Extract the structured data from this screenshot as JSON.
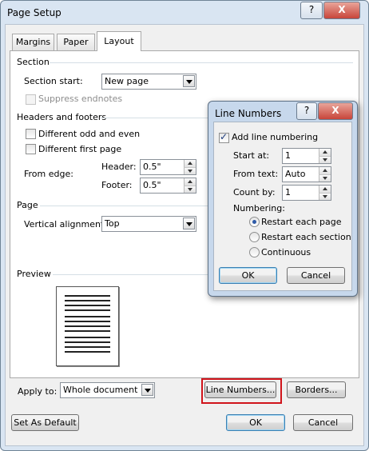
{
  "dialog": {
    "title": "Page Setup",
    "help_label": "?",
    "close_label": "X",
    "tabs": [
      {
        "label": "Margins",
        "active": false
      },
      {
        "label": "Paper",
        "active": false
      },
      {
        "label": "Layout",
        "active": true
      }
    ]
  },
  "section": {
    "header": "Section",
    "section_start_label": "Section start:",
    "section_start_value": "New page",
    "suppress_endnotes_label": "Suppress endnotes",
    "suppress_endnotes_checked": false
  },
  "headers_footers": {
    "header": "Headers and footers",
    "diff_odd_even_label": "Different odd and even",
    "diff_first_page_label": "Different first page",
    "from_edge_label": "From edge:",
    "header_label": "Header:",
    "header_value": "0.5\"",
    "footer_label": "Footer:",
    "footer_value": "0.5\""
  },
  "page": {
    "header": "Page",
    "vertical_alignment_label": "Vertical alignment:",
    "vertical_alignment_value": "Top"
  },
  "preview": {
    "header": "Preview"
  },
  "apply": {
    "label": "Apply to:",
    "value": "Whole document"
  },
  "buttons": {
    "line_numbers": "Line Numbers...",
    "borders": "Borders...",
    "set_as_default": "Set As Default",
    "ok": "OK",
    "cancel": "Cancel"
  },
  "line_numbers_dialog": {
    "title": "Line Numbers",
    "help_label": "?",
    "add_line_numbering_label": "Add line numbering",
    "add_line_numbering_checked": true,
    "start_at_label": "Start at:",
    "start_at_value": "1",
    "from_text_label": "From text:",
    "from_text_value": "Auto",
    "count_by_label": "Count by:",
    "count_by_value": "1",
    "numbering_label": "Numbering:",
    "options": [
      "Restart each page",
      "Restart each section",
      "Continuous"
    ],
    "selected_option": "Restart each page",
    "ok": "OK",
    "cancel": "Cancel"
  },
  "colors": {
    "highlight": "#d0141b",
    "title_bar": "#d9e5f2"
  }
}
